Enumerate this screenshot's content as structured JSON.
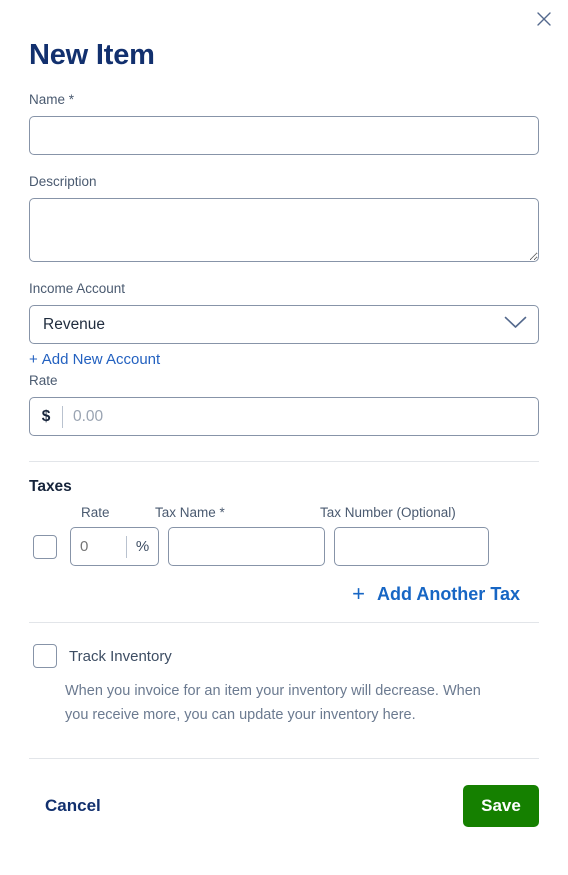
{
  "modal": {
    "title": "New Item",
    "close_icon": "close-icon"
  },
  "fields": {
    "name": {
      "label": "Name *",
      "value": "",
      "placeholder": ""
    },
    "description": {
      "label": "Description",
      "value": "",
      "placeholder": ""
    },
    "income_account": {
      "label": "Income Account",
      "selected": "Revenue",
      "options": [
        "Revenue"
      ],
      "chevron_icon": "chevron-down-icon",
      "add_link": {
        "plus": "+",
        "label": "Add New Account"
      }
    },
    "rate": {
      "label": "Rate",
      "currency_symbol": "$",
      "value": "",
      "placeholder": "0.00"
    }
  },
  "taxes": {
    "heading": "Taxes",
    "columns": {
      "rate": "Rate",
      "name": "Tax Name *",
      "number": "Tax Number (Optional)"
    },
    "rows": [
      {
        "selected": false,
        "rate_value": "",
        "rate_placeholder": "0",
        "percent_symbol": "%",
        "name_value": "",
        "name_placeholder": "",
        "number_value": "",
        "number_placeholder": ""
      }
    ],
    "add_link": {
      "plus": "+",
      "label": "Add Another Tax"
    }
  },
  "inventory": {
    "checked": false,
    "label": "Track Inventory",
    "description": "When you invoice for an item your inventory will decrease. When you receive more, you can update your inventory here."
  },
  "footer": {
    "cancel_label": "Cancel",
    "save_label": "Save"
  },
  "colors": {
    "title_navy": "#12306e",
    "link_blue": "#2361c0",
    "add_tax_blue": "#1766c4",
    "save_green": "#158000",
    "border_slate": "#8794a8",
    "divider_gray": "#e2e5e9",
    "body_text": "#3d4d63",
    "muted_text": "#6b7a90"
  }
}
